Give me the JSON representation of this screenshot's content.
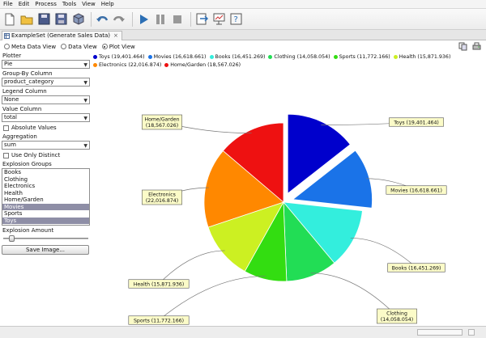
{
  "menu": [
    "File",
    "Edit",
    "Process",
    "Tools",
    "View",
    "Help"
  ],
  "tab": {
    "title": "ExampleSet (Generate Sales Data)",
    "close": "×"
  },
  "views": {
    "meta": "Meta Data View",
    "data": "Data View",
    "plot": "Plot View",
    "selected": "plot"
  },
  "sidebar": {
    "plotter_label": "Plotter",
    "plotter_value": "Pie",
    "group_by_label": "Group-By Column",
    "group_by_value": "product_category",
    "legend_label": "Legend Column",
    "legend_value": "None",
    "value_label": "Value Column",
    "value_value": "total",
    "absolute_values": "Absolute Values",
    "aggregation_label": "Aggregation",
    "aggregation_value": "sum",
    "use_only_distinct": "Use Only Distinct",
    "explosion_groups_label": "Explosion Groups",
    "explosion_groups": [
      {
        "label": "Books",
        "selected": false
      },
      {
        "label": "Clothing",
        "selected": false
      },
      {
        "label": "Electronics",
        "selected": false
      },
      {
        "label": "Health",
        "selected": false
      },
      {
        "label": "Home/Garden",
        "selected": false
      },
      {
        "label": "Movies",
        "selected": true
      },
      {
        "label": "Sports",
        "selected": false
      },
      {
        "label": "Toys",
        "selected": true
      }
    ],
    "explosion_amount_label": "Explosion Amount",
    "save_button": "Save Image..."
  },
  "chart_data": {
    "type": "pie",
    "title": "",
    "series": [
      {
        "name": "Toys",
        "value": 19401.464,
        "color": "#0000cc",
        "exploded": true,
        "label": "Toys (19,401.464)"
      },
      {
        "name": "Movies",
        "value": 16618.661,
        "color": "#1a73e8",
        "exploded": true,
        "label": "Movies (16,618.661)"
      },
      {
        "name": "Books",
        "value": 16451.269,
        "color": "#33eedd",
        "exploded": false,
        "label": "Books (16,451.269)"
      },
      {
        "name": "Clothing",
        "value": 14058.054,
        "color": "#22dd55",
        "exploded": false,
        "label": "Clothing\n(14,058.054)"
      },
      {
        "name": "Sports",
        "value": 11772.166,
        "color": "#33dd11",
        "exploded": false,
        "label": "Sports (11,772.166)"
      },
      {
        "name": "Health",
        "value": 15871.936,
        "color": "#ccf022",
        "exploded": false,
        "label": "Health (15,871.936)"
      },
      {
        "name": "Electronics",
        "value": 22016.874,
        "color": "#ff8800",
        "exploded": false,
        "label": "Electronics\n(22,016.874)"
      },
      {
        "name": "Home/Garden",
        "value": 18567.026,
        "color": "#ee1111",
        "exploded": false,
        "label": "Home/Garden\n(18,567.026)"
      }
    ],
    "legend": {
      "placement": "top-left",
      "row1": [
        "Toys (19,401.464)",
        "Movies (16,618.661)",
        "Books (16,451.269)",
        "Clothing (14,058.054)",
        "Sports (11,772.166)",
        "Health (15,871.936)"
      ],
      "row2": [
        "Electronics (22,016.874)",
        "Home/Garden (18,567.026)"
      ]
    }
  }
}
